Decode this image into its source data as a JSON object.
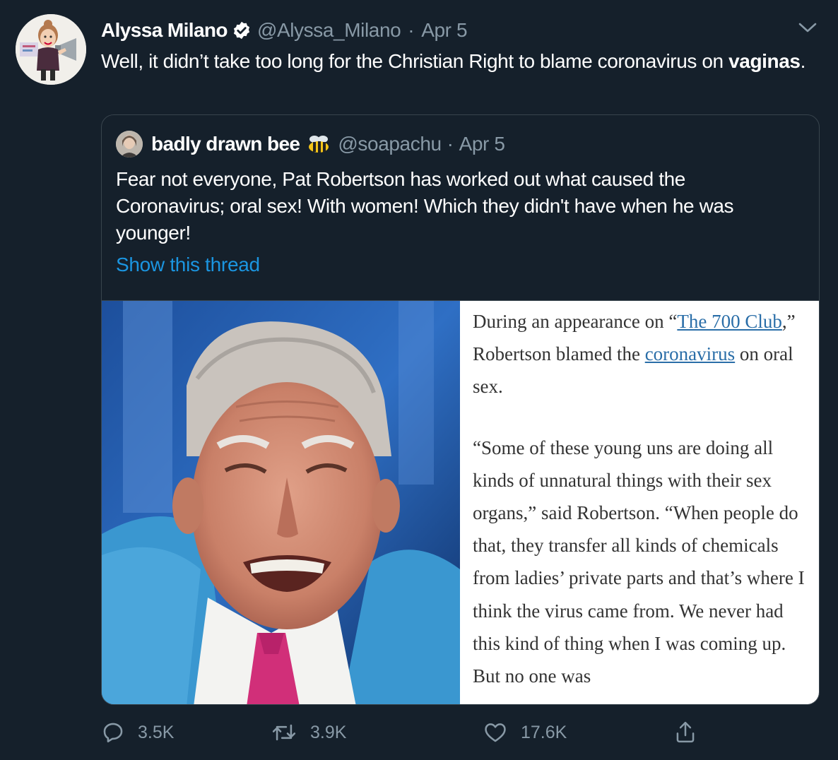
{
  "tweet": {
    "author_name": "Alyssa Milano",
    "handle": "@Alyssa_Milano",
    "separator": "·",
    "date": "Apr 5",
    "text_main": "Well, it didn’t take too long for the Christian Right to blame coronavirus on ",
    "text_bold": "vaginas",
    "text_end": ".",
    "verified_icon": "verified-badge-icon",
    "more_icon": "chevron-down-icon"
  },
  "quoted": {
    "author_name": "badly drawn bee",
    "handle": "@soapachu",
    "separator": "·",
    "date": "Apr 5",
    "text": "Fear not everyone, Pat Robertson has worked out what caused the Coronavirus; oral sex! With women! Which they didn't have when he was younger!",
    "show_thread": "Show this thread",
    "article": {
      "p1_a": "During an appearance on “",
      "p1_link1": "The 700 Club",
      "p1_b": ",” Robertson blamed the ",
      "p1_link2": "coronavirus",
      "p1_c": " on oral sex.",
      "p2": "“Some of these young uns are doing all kinds of unnatural things with their sex organs,” said Robertson. “When people do that, they transfer all kinds of chemicals from ladies’ private parts and that’s where I think the virus came from. We never had this kind of thing when I was coming up. But no one was"
    }
  },
  "actions": {
    "replies": "3.5K",
    "retweets": "3.9K",
    "likes": "17.6K"
  },
  "colors": {
    "background": "#15202b",
    "border": "#38444d",
    "secondary_text": "#8899a6",
    "link": "#1b95e0"
  }
}
